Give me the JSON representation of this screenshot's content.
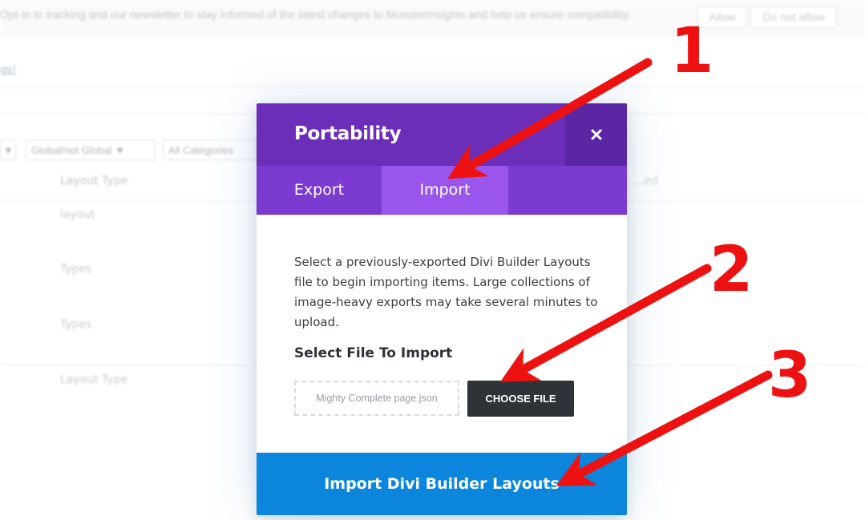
{
  "background": {
    "notice_text": "Opt-in to tracking and our newsletter to stay informed of the latest changes to MonsterInsights and help us ensure compatibility.",
    "allow_label": "Allow",
    "disallow_label": "Do not allow",
    "link_text": "gs!",
    "filters": [
      "▼",
      "Global/not Global ▼",
      "All Categories"
    ],
    "column_header": "Layout Type",
    "column_header_right": "...ed",
    "rows": [
      "layout",
      "Types",
      "Types",
      "Layout Type"
    ]
  },
  "modal": {
    "title": "Portability",
    "close_icon": "close-icon",
    "tabs": [
      {
        "label": "Export",
        "active": false
      },
      {
        "label": "Import",
        "active": true
      }
    ],
    "description": "Select a previously-exported Divi Builder Layouts file to begin importing items. Large collections of image-heavy exports may take several minutes to upload.",
    "section_label": "Select File To Import",
    "file_name": "Mighty Complete page.json",
    "choose_file_label": "CHOOSE FILE",
    "import_button_label": "Import Divi Builder Layouts"
  },
  "annotations": {
    "numbers": [
      "1",
      "2",
      "3"
    ],
    "color": "#ee1111"
  },
  "colors": {
    "header": "#6c2eb9",
    "close_bg": "#5b26a3",
    "tabs_bg": "#7b3bd1",
    "active_tab": "#9a55ec",
    "choose_file_bg": "#2e3338",
    "import_bg": "#0c85dc"
  }
}
